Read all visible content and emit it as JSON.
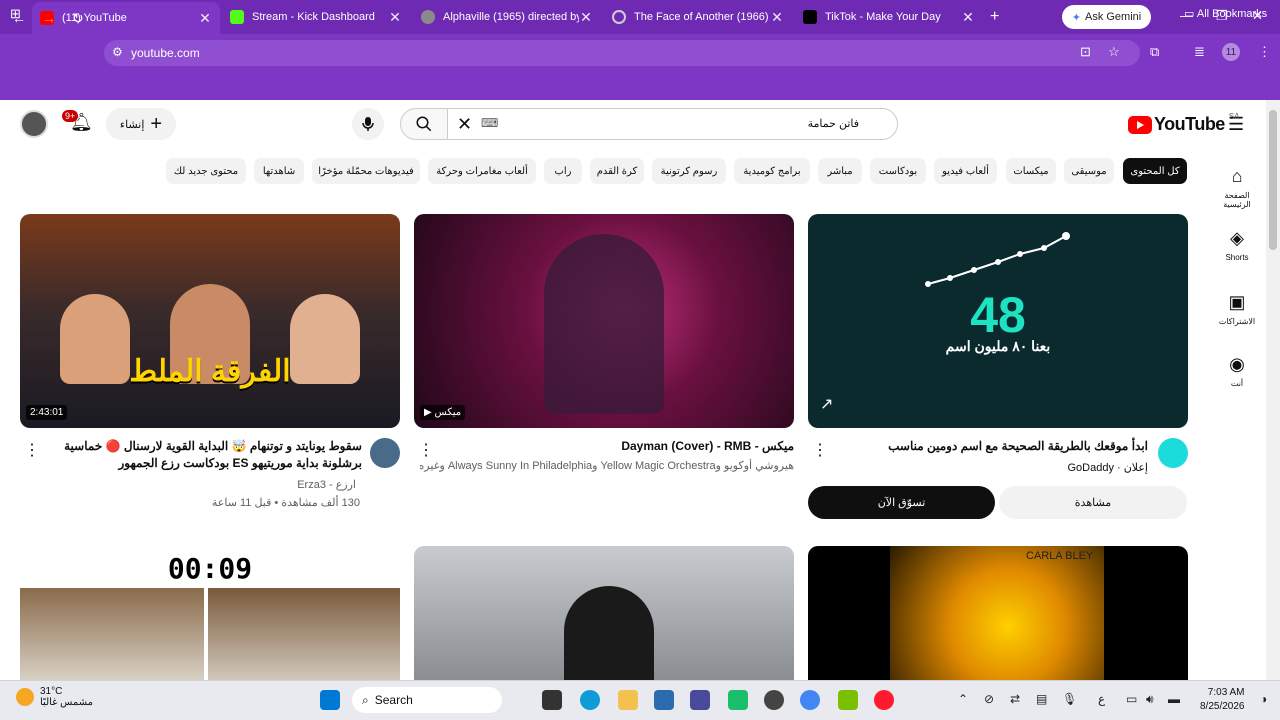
{
  "browser": {
    "tabs": [
      {
        "title": "(11) YouTube",
        "color": "#ff0000"
      },
      {
        "title": "Stream - Kick Dashboard",
        "color": "#53fc18"
      },
      {
        "title": "Alphaville (1965) directed by",
        "color": "#8a8a8a"
      },
      {
        "title": "The Face of Another (1966) | T",
        "color": "#cfcfcf"
      },
      {
        "title": "TikTok - Make Your Day",
        "color": "#000000"
      }
    ],
    "gemini_label": "Ask Gemini",
    "url": "youtube.com",
    "profile_initial": "11",
    "all_bookmarks": "All Bookmarks"
  },
  "youtube": {
    "logo_text": "YouTube",
    "country_code": "SA",
    "search_query": "فاتن حمامة",
    "create_label": "إنشاء",
    "notification_count": "9+",
    "chips": [
      {
        "label": "كل المحتوى",
        "selected": true
      },
      {
        "label": "موسيقى",
        "selected": false
      },
      {
        "label": "ميكسات",
        "selected": false
      },
      {
        "label": "ألعاب فيديو",
        "selected": false
      },
      {
        "label": "بودكاست",
        "selected": false
      },
      {
        "label": "مباشر",
        "selected": false
      },
      {
        "label": "برامج كوميدية",
        "selected": false
      },
      {
        "label": "رسوم كرتونية",
        "selected": false
      },
      {
        "label": "كرة القدم",
        "selected": false
      },
      {
        "label": "راب",
        "selected": false
      },
      {
        "label": "ألعاب مغامرات وحركة",
        "selected": false
      },
      {
        "label": "فيديوهات محمّلة مؤخرًا",
        "selected": false
      },
      {
        "label": "شاهدتها",
        "selected": false
      },
      {
        "label": "محتوى جديد لك",
        "selected": false
      }
    ],
    "rail": [
      {
        "label": "الصفحة الرئيسية",
        "icon": "home-icon"
      },
      {
        "label": "Shorts",
        "icon": "shorts-icon"
      },
      {
        "label": "الاشتراكات",
        "icon": "subscriptions-icon"
      },
      {
        "label": "أنت",
        "icon": "you-icon"
      }
    ],
    "ad": {
      "number": "48",
      "tagline": "بعنا ٨٠ مليون اسم",
      "title": "ابدأ موقعك بالطريقة الصحيحة مع اسم دومين مناسب",
      "sponsor": "إعلان · GoDaddy",
      "shop_label": "تسوّق الآن",
      "watch_label": "مشاهدة"
    },
    "mix": {
      "title": "ميكس - Dayman (Cover) - RMB",
      "subtitle": "هيروشي أوكويو وYellow Magic Orchestra وAlways Sunny In Philadelphia وغيره...",
      "badge": "ميكس"
    },
    "video1": {
      "title": "سقوط يونايتد و توتنهام 🤯 البداية القوية لارسنال 🔴 خماسية برشلونة بداية موريتيهو ES بودكاست رزع الجمهور",
      "channel": "ارزع - Erza3",
      "stats": "130 ألف مشاهدة • قبل 11 ساعة",
      "duration": "2:43:01",
      "thumb_text": "الفرقة الملط"
    },
    "video4": {
      "timer": "00:09"
    },
    "video6": {
      "caption": "CARLA BLEY"
    }
  },
  "taskbar": {
    "temp": "31°C",
    "weather": "مشمس غالبًا",
    "search_label": "Search",
    "time": "7:03 AM",
    "date": "8/25/2026",
    "lang": "ع"
  }
}
